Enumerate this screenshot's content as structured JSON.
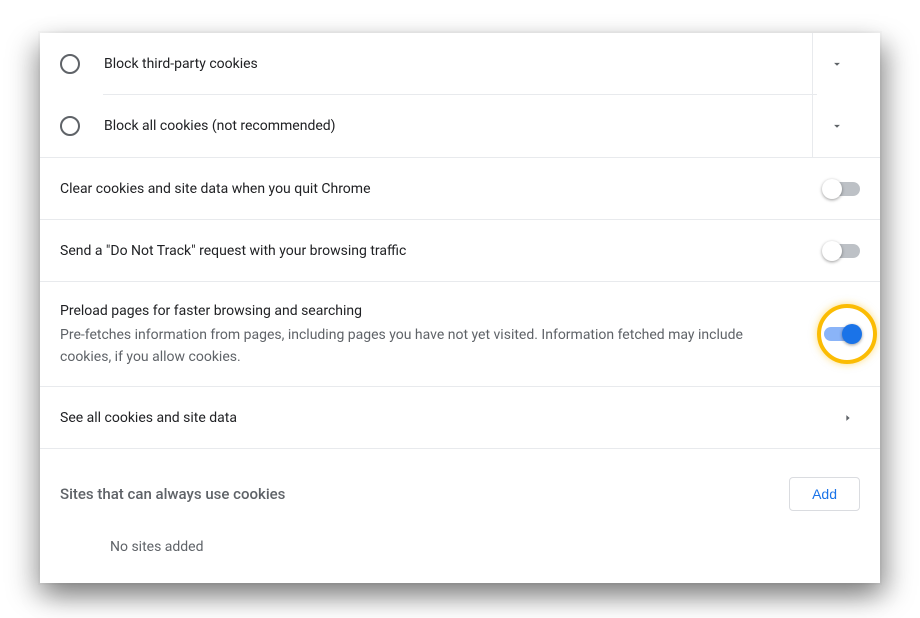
{
  "radios": [
    {
      "label": "Block third-party cookies"
    },
    {
      "label": "Block all cookies (not recommended)"
    }
  ],
  "toggles": {
    "clearOnQuit": {
      "label": "Clear cookies and site data when you quit Chrome",
      "on": false
    },
    "doNotTrack": {
      "label": "Send a \"Do Not Track\" request with your browsing traffic",
      "on": false
    },
    "preload": {
      "title": "Preload pages for faster browsing and searching",
      "sub": "Pre-fetches information from pages, including pages you have not yet visited. Information fetched may include cookies, if you allow cookies.",
      "on": true,
      "highlighted": true
    }
  },
  "nav": {
    "seeAll": "See all cookies and site data"
  },
  "section": {
    "title": "Sites that can always use cookies",
    "addBtn": "Add",
    "empty": "No sites added"
  }
}
